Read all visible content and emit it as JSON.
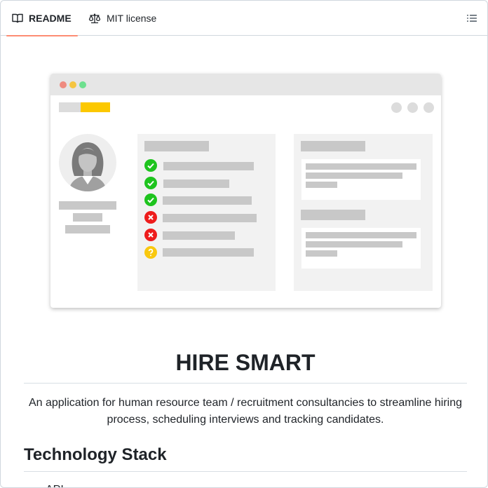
{
  "tabs": {
    "readme_label": "README",
    "license_label": "MIT license",
    "readme_icon": "book-icon",
    "license_icon": "scale-icon",
    "toc_icon": "list-icon"
  },
  "illustration": {
    "window_dots": [
      "#ef8b80",
      "#f5c542",
      "#6ee08f"
    ],
    "status_items": [
      "check",
      "check",
      "check",
      "cross",
      "cross",
      "question"
    ],
    "colors": {
      "check": "#1ec41e",
      "cross": "#ee1c1c",
      "question": "#f9c80f",
      "accent": "#fcc800"
    }
  },
  "readme": {
    "title": "HIRE SMART",
    "description": "An application for human resource team / recruitment consultancies to streamline hiring process, scheduling interviews and tracking candidates.",
    "section_title": "Technology Stack",
    "list_items": [
      "API"
    ]
  },
  "theme": {
    "tab_underline": "#fd8c73",
    "border": "#d0d7de",
    "text": "#1f2328"
  }
}
